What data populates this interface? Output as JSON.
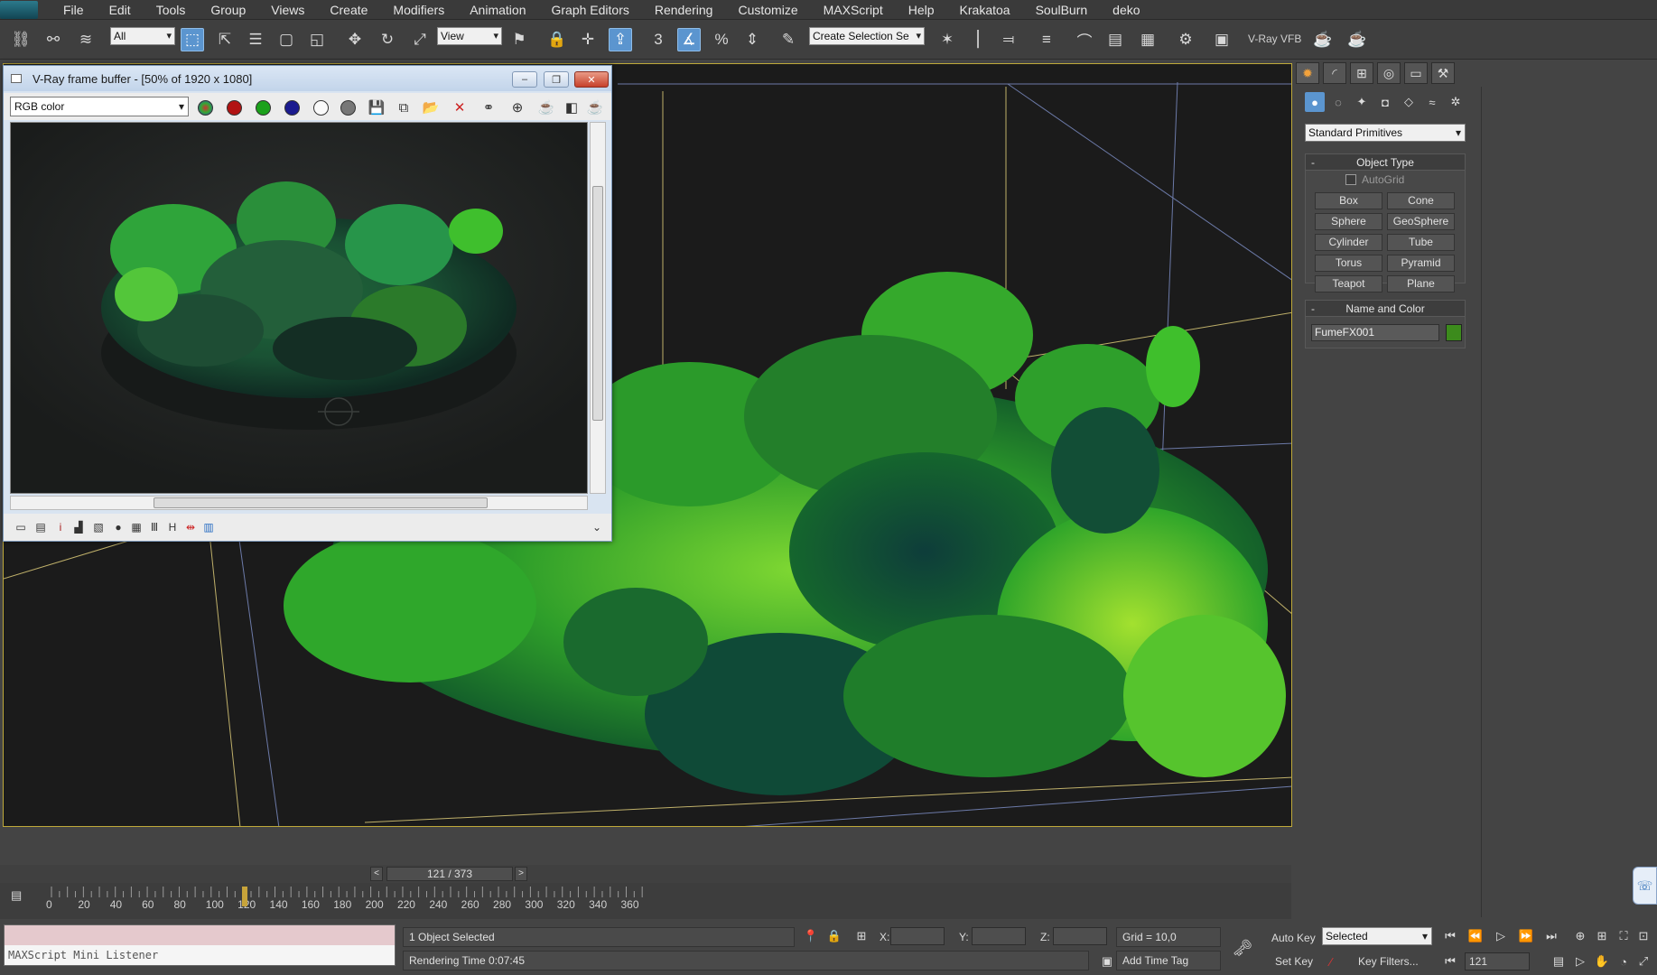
{
  "menubar": {
    "items": [
      "File",
      "Edit",
      "Tools",
      "Group",
      "Views",
      "Create",
      "Modifiers",
      "Animation",
      "Graph Editors",
      "Rendering",
      "Customize",
      "MAXScript",
      "Help",
      "Krakatoa",
      "SoulBurn",
      "deko"
    ]
  },
  "toolbar": {
    "selection_filter": "All",
    "ref_coord_system": "View",
    "named_selection_set": "Create Selection Se",
    "vray_vfb_label": "V-Ray VFB",
    "snap_label": "3"
  },
  "vfb": {
    "title": "V-Ray frame buffer - [50% of 1920 x 1080]",
    "channel": "RGB color"
  },
  "command_panel": {
    "dropdown": "Standard Primitives",
    "object_type": {
      "title": "Object Type",
      "autogrid_label": "AutoGrid",
      "buttons": [
        "Box",
        "Cone",
        "Sphere",
        "GeoSphere",
        "Cylinder",
        "Tube",
        "Torus",
        "Pyramid",
        "Teapot",
        "Plane"
      ]
    },
    "name_and_color": {
      "title": "Name and Color",
      "object_name": "FumeFX001",
      "color": "#3c8b1c"
    }
  },
  "timeline": {
    "frame_display": "121 / 373",
    "current_frame": 121,
    "total_frames": 373,
    "ticks": [
      "0",
      "20",
      "40",
      "60",
      "80",
      "100",
      "120",
      "140",
      "160",
      "180",
      "200",
      "220",
      "240",
      "260",
      "280",
      "300",
      "320",
      "340",
      "360"
    ]
  },
  "status": {
    "listener_label": "MAXScript Mini Listener",
    "selection_info": "1 Object Selected",
    "rendering_time": "Rendering Time  0:07:45",
    "x_label": "X:",
    "y_label": "Y:",
    "z_label": "Z:",
    "grid": "Grid = 10,0",
    "add_time_tag": "Add Time Tag",
    "auto_key": "Auto Key",
    "set_key": "Set Key",
    "key_mode": "Selected",
    "key_filters": "Key Filters...",
    "frame_field": "121"
  },
  "colors": {
    "accent_blue": "#5b95cf",
    "viewport_border": "#bfa93a",
    "listener_pink": "#e5c9cd",
    "smoke_green": "#3fc12b"
  }
}
